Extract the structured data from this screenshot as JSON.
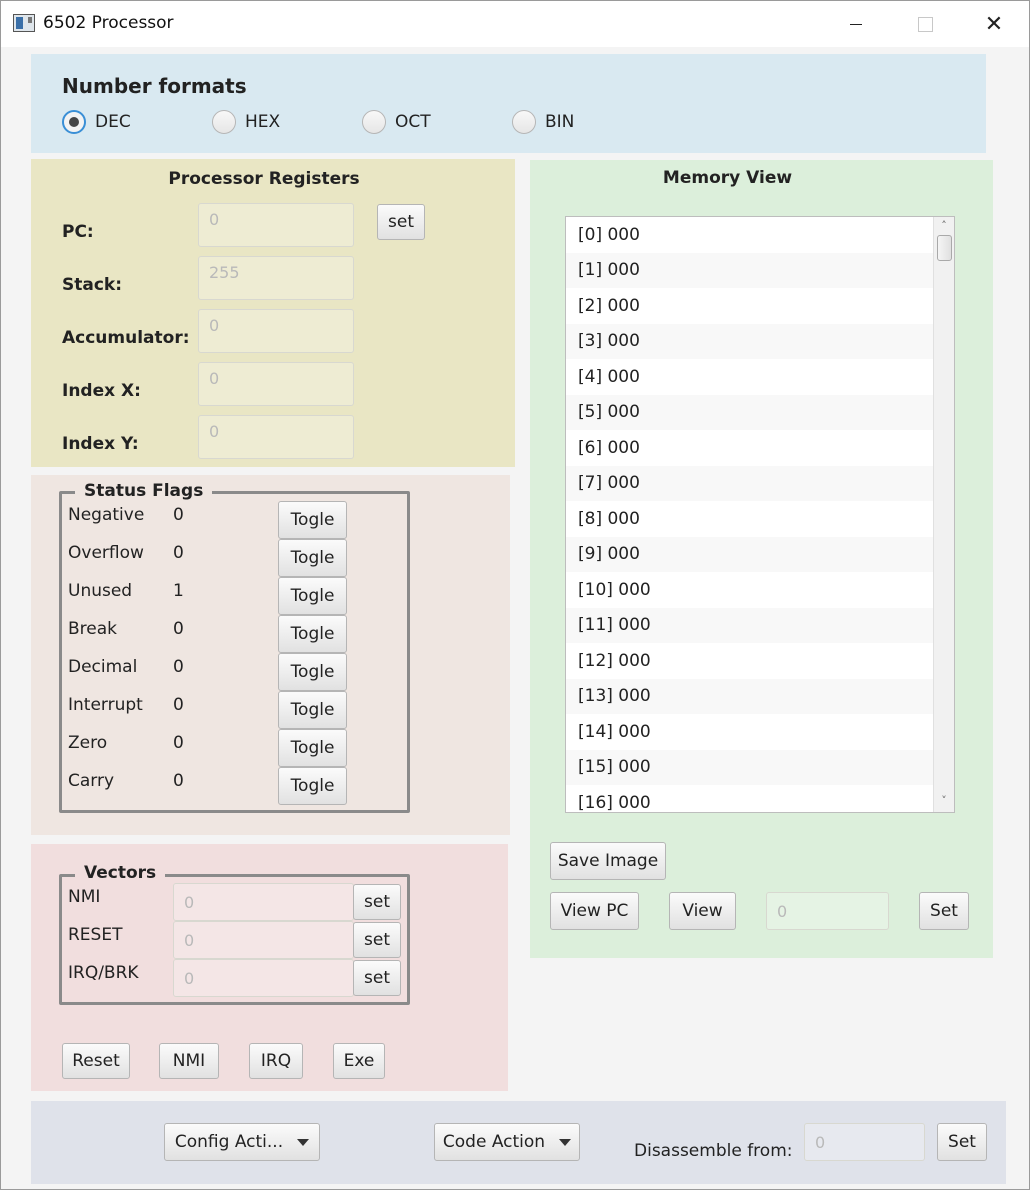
{
  "window": {
    "title": "6502 Processor",
    "minimize": "—",
    "maximize": "☐",
    "close": "✕"
  },
  "formats": {
    "heading": "Number formats",
    "options": [
      {
        "label": "DEC",
        "selected": true
      },
      {
        "label": "HEX",
        "selected": false
      },
      {
        "label": "OCT",
        "selected": false
      },
      {
        "label": "BIN",
        "selected": false
      }
    ]
  },
  "registers": {
    "heading": "Processor Registers",
    "pc": {
      "label": "PC:",
      "value": "0",
      "set_label": "set"
    },
    "stack": {
      "label": "Stack:",
      "value": "255"
    },
    "accumulator": {
      "label": "Accumulator:",
      "value": "0"
    },
    "index_x": {
      "label": "Index X:",
      "value": "0"
    },
    "index_y": {
      "label": "Index Y:",
      "value": "0"
    }
  },
  "flags": {
    "heading": "Status Flags",
    "toggle_label": "Togle",
    "items": [
      {
        "name": "Negative",
        "value": "0"
      },
      {
        "name": "Overflow",
        "value": "0"
      },
      {
        "name": "Unused",
        "value": "1"
      },
      {
        "name": "Break",
        "value": "0"
      },
      {
        "name": "Decimal",
        "value": "0"
      },
      {
        "name": "Interrupt",
        "value": "0"
      },
      {
        "name": "Zero",
        "value": "0"
      },
      {
        "name": "Carry",
        "value": "0"
      }
    ]
  },
  "vectors": {
    "heading": "Vectors",
    "set_label": "set",
    "items": [
      {
        "name": "NMI",
        "value": "0"
      },
      {
        "name": "RESET",
        "value": "0"
      },
      {
        "name": "IRQ/BRK",
        "value": "0"
      }
    ],
    "actions": {
      "reset": "Reset",
      "nmi": "NMI",
      "irq": "IRQ",
      "exe": "Exe"
    }
  },
  "memory": {
    "heading": "Memory View",
    "rows": [
      "[0] 000",
      "[1] 000",
      "[2] 000",
      "[3] 000",
      "[4] 000",
      "[5] 000",
      "[6] 000",
      "[7] 000",
      "[8] 000",
      "[9] 000",
      "[10] 000",
      "[11] 000",
      "[12] 000",
      "[13] 000",
      "[14] 000",
      "[15] 000",
      "[16] 000"
    ],
    "save_image_label": "Save Image",
    "view_pc_label": "View PC",
    "view_label": "View",
    "address_value": "0",
    "set_label": "Set"
  },
  "bottom": {
    "config_action_label": "Config Acti...",
    "code_action_label": "Code Action",
    "disassemble_label": "Disassemble from:",
    "disassemble_value": "0",
    "set_label": "Set"
  }
}
